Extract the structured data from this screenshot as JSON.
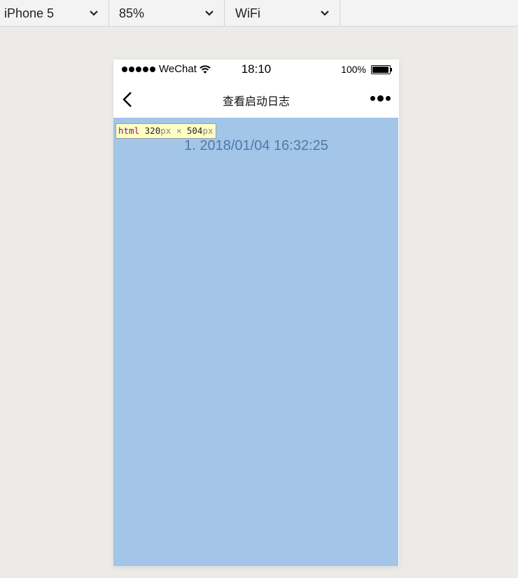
{
  "toolbar": {
    "device": "iPhone 5",
    "zoom": "85%",
    "network": "WiFi"
  },
  "statusbar": {
    "carrier": "WeChat",
    "time": "18:10",
    "battery": "100%"
  },
  "navbar": {
    "title": "查看启动日志"
  },
  "content": {
    "background": "#a2c5e8",
    "log_items": [
      "1. 2018/01/04 16:32:25"
    ]
  },
  "inspector_tooltip": {
    "tag": "html",
    "width": "320",
    "height": "504",
    "unit": "px",
    "times": "×"
  }
}
